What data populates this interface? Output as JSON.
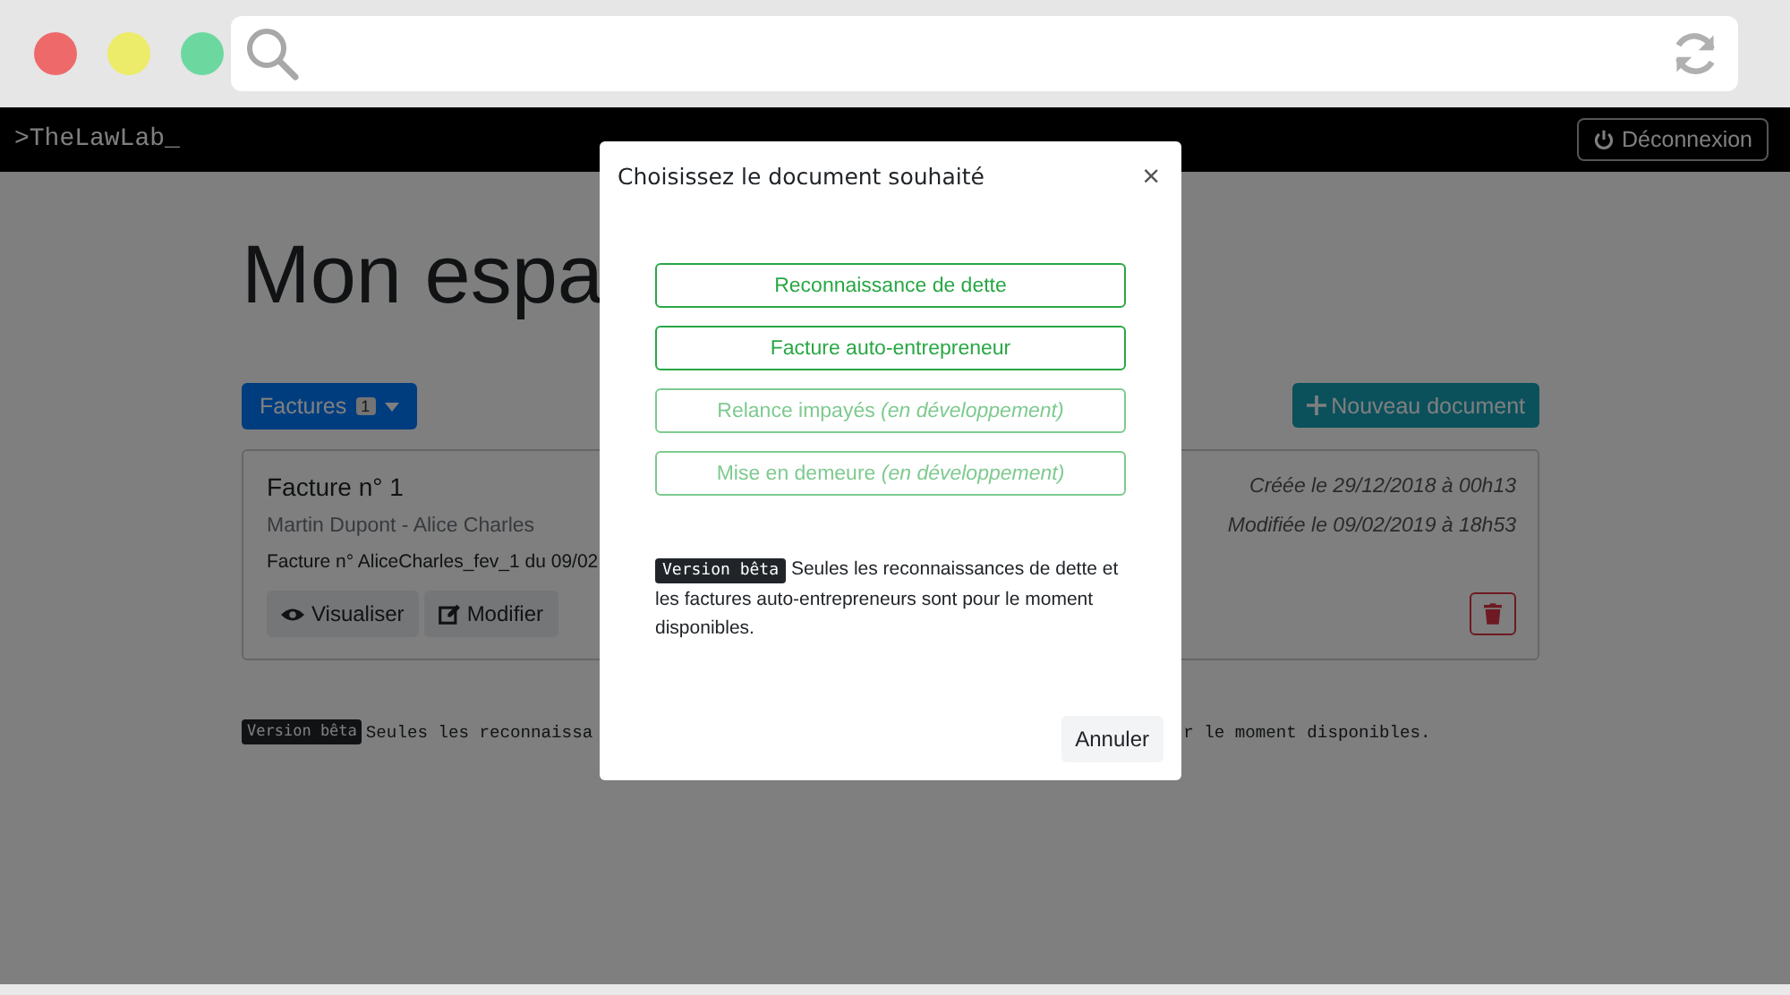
{
  "navbar": {
    "brand": ">TheLawLab_",
    "logout_button": "Déconnexion"
  },
  "page": {
    "title": "Mon espa",
    "category_button": {
      "label": "Factures",
      "count": "1"
    },
    "new_button": "Nouveau document",
    "documents": [
      {
        "title": "Facture n° 1",
        "parties": "Martin Dupont - Alice Charles",
        "reference": "Facture n° AliceCharles_fev_1 du 09/02",
        "created": "Créée le 29/12/2018 à 00h13",
        "modified": "Modifiée le 09/02/2019 à 18h53",
        "view_button": "Visualiser",
        "edit_button": "Modifier"
      }
    ],
    "notice": {
      "badge": "Version bêta",
      "text_left": "Seules les reconnaissa",
      "text_right": "r le moment disponibles."
    }
  },
  "modal": {
    "title": "Choisissez le document souhaité",
    "close": "×",
    "options": [
      {
        "label": "Reconnaissance de dette",
        "disabled": false
      },
      {
        "label": "Facture auto-entrepreneur",
        "disabled": false
      },
      {
        "label": "Relance impayés *(en développement)*",
        "disabled": true
      },
      {
        "label": "Mise en demeure *(en développement)*",
        "disabled": true
      }
    ],
    "notice": {
      "badge": "Version bêta",
      "text": "Seules les reconnaissances de dette et les factures auto-entrepreneurs sont pour le moment disponibles."
    },
    "cancel_button": "Annuler"
  }
}
